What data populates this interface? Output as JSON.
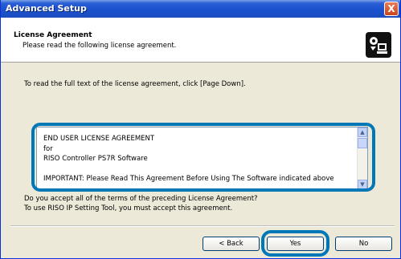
{
  "window": {
    "title": "Advanced Setup",
    "close_symbol": "X"
  },
  "header": {
    "title": "License Agreement",
    "subtitle": "Please read the following license agreement.",
    "icon": "setup-computer-icon"
  },
  "main": {
    "instruction": "To read the full text of the license agreement, click [Page Down].",
    "license_lines": [
      "END USER LICENSE AGREEMENT",
      "for",
      "RISO Controller PS7R Software",
      "",
      "IMPORTANT: Please Read This Agreement Before Using The Software indicated above"
    ],
    "question_line1": "Do you accept all of the terms of the preceding License Agreement?",
    "question_line2": "To use RISO IP Setting Tool, you must accept this agreement."
  },
  "buttons": {
    "back": "< Back",
    "yes": "Yes",
    "no": "No"
  },
  "colors": {
    "highlight": "#0078B8",
    "titlebar": "#1C52CF",
    "dialog_bg": "#ECE9D8"
  }
}
